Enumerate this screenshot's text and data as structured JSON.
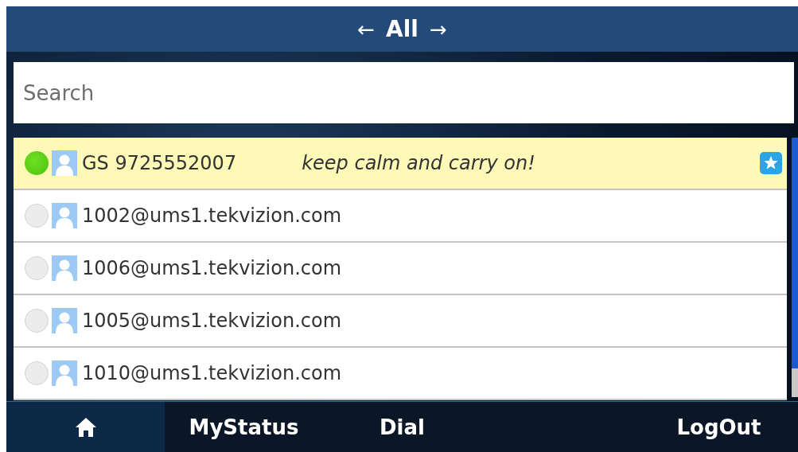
{
  "header": {
    "prev": "←",
    "title": "All",
    "next": "→"
  },
  "search": {
    "placeholder": "Search"
  },
  "contacts": [
    {
      "name": "GS 9725552007",
      "status_message": "keep calm and carry on!",
      "online": true,
      "selected": true,
      "favorite": true
    },
    {
      "name": "1002@ums1.tekvizion.com",
      "online": false,
      "selected": false,
      "favorite": false
    },
    {
      "name": "1006@ums1.tekvizion.com",
      "online": false,
      "selected": false,
      "favorite": false
    },
    {
      "name": "1005@ums1.tekvizion.com",
      "online": false,
      "selected": false,
      "favorite": false
    },
    {
      "name": "1010@ums1.tekvizion.com",
      "online": false,
      "selected": false,
      "favorite": false
    }
  ],
  "softkeys": [
    {
      "kind": "home",
      "selected": true
    },
    {
      "kind": "label",
      "label": "MyStatus",
      "selected": false
    },
    {
      "kind": "label",
      "label": "Dial",
      "selected": false
    },
    {
      "kind": "empty",
      "selected": false
    },
    {
      "kind": "label",
      "label": "LogOut",
      "selected": false
    }
  ]
}
